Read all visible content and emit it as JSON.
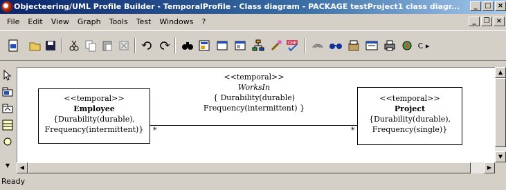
{
  "window": {
    "title": "Objecteering/UML Profile Builder - TemporalProfile - Class diagram - PACKAGE  testProject1 class diagr..."
  },
  "menu": {
    "items": [
      "File",
      "Edit",
      "View",
      "Graph",
      "Tools",
      "Test",
      "Windows",
      "?"
    ]
  },
  "toolbar": {
    "icons": [
      "new-diagram-icon",
      "open-folder-icon",
      "save-icon",
      "cut-icon",
      "copy-icon",
      "paste-icon",
      "delete-icon",
      "undo-icon",
      "redo-icon",
      "find-icon",
      "properties-icon",
      "window-icon",
      "window2-icon",
      "hierarchy-icon",
      "wand-icon",
      "check-icon",
      "link-icon",
      "glasses-icon",
      "package-icon",
      "view-icon",
      "print-icon",
      "settings-icon"
    ]
  },
  "diagram": {
    "left_class": {
      "stereotype": "<<temporal>>",
      "name": "Employee",
      "tags_line1": "{Durability(durable),",
      "tags_line2": "Frequency(intermittent)}"
    },
    "right_class": {
      "stereotype": "<<temporal>>",
      "name": "Project",
      "tags_line1": "{Durability(durable),",
      "tags_line2": "Frequency(single)}"
    },
    "association": {
      "stereotype": "<<temporal>>",
      "name": "WorksIn",
      "tags_line1": "{ Durability(durable)",
      "tags_line2": "Frequency(intermittent) }",
      "left_multiplicity": "*",
      "right_multiplicity": "*"
    }
  },
  "status": {
    "text": "Ready"
  }
}
